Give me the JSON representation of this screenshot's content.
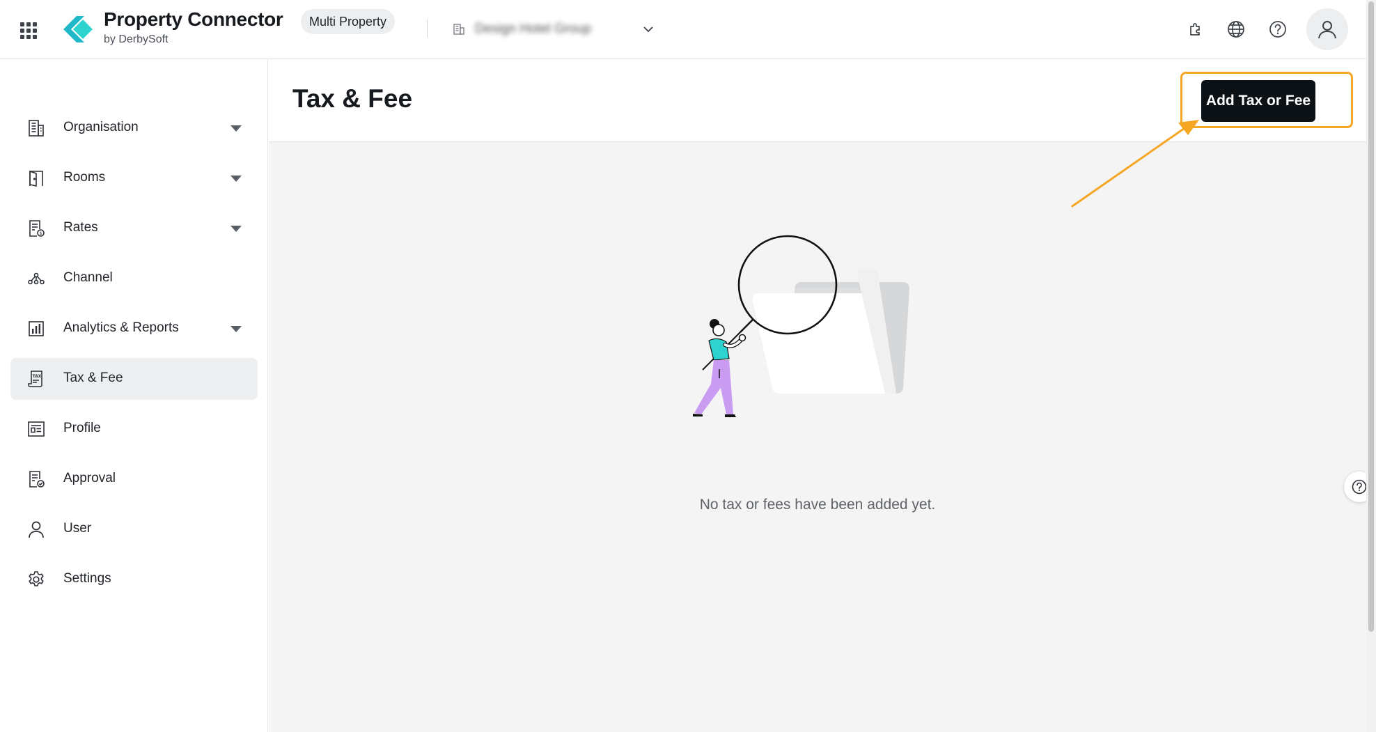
{
  "header": {
    "brand_title": "Property Connector",
    "brand_sub": "by DerbySoft",
    "mode_badge": "Multi Property",
    "org_name": "Design Hotel Group",
    "icons": [
      "apps-grid-icon",
      "puzzle-icon",
      "globe-icon",
      "help-icon",
      "user-icon"
    ]
  },
  "sidebar": {
    "items": [
      {
        "label": "Organisation",
        "icon": "building-icon",
        "expandable": true
      },
      {
        "label": "Rooms",
        "icon": "door-icon",
        "expandable": true
      },
      {
        "label": "Rates",
        "icon": "rate-doc-icon",
        "expandable": true
      },
      {
        "label": "Channel",
        "icon": "channel-icon",
        "expandable": false
      },
      {
        "label": "Analytics & Reports",
        "icon": "chart-icon",
        "expandable": true
      },
      {
        "label": "Tax & Fee",
        "icon": "tax-icon",
        "expandable": false,
        "active": true
      },
      {
        "label": "Profile",
        "icon": "profile-card-icon",
        "expandable": false
      },
      {
        "label": "Approval",
        "icon": "approval-icon",
        "expandable": false
      },
      {
        "label": "User",
        "icon": "user-icon",
        "expandable": false
      },
      {
        "label": "Settings",
        "icon": "gear-icon",
        "expandable": false
      }
    ]
  },
  "main": {
    "title": "Tax & Fee",
    "add_button": "Add Tax or Fee",
    "empty_message": "No tax or fees have been added yet."
  },
  "colors": {
    "accent_teal": "#2ed3d0",
    "highlight": "#f5a623",
    "button_dark": "#0c1116",
    "figure_shirt": "#2ed3d0",
    "figure_pants": "#c99cf2"
  }
}
